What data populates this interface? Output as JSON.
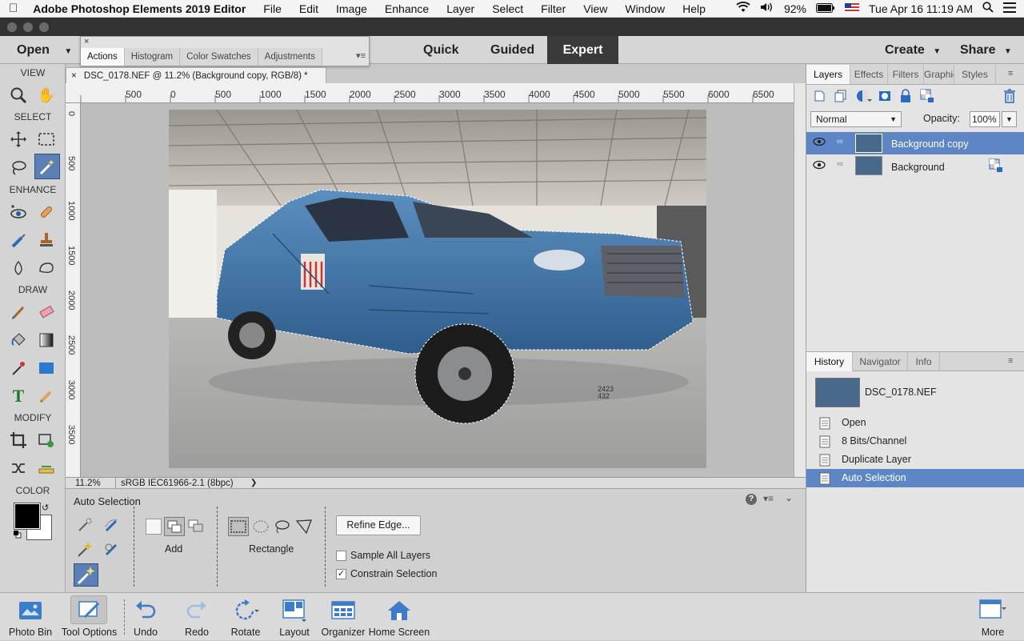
{
  "menubar": {
    "app": "Adobe Photoshop Elements 2019 Editor",
    "items": [
      "File",
      "Edit",
      "Image",
      "Enhance",
      "Layer",
      "Select",
      "Filter",
      "View",
      "Window",
      "Help"
    ],
    "battery": "92%",
    "datetime": "Tue Apr 16  11:19 AM"
  },
  "topbar": {
    "open": "Open",
    "modes": [
      "Quick",
      "Guided",
      "Expert"
    ],
    "create": "Create",
    "share": "Share"
  },
  "floatpanel": {
    "tabs": [
      "Actions",
      "Histogram",
      "Color Swatches",
      "Adjustments"
    ]
  },
  "toolbox": {
    "sections": [
      "VIEW",
      "SELECT",
      "ENHANCE",
      "DRAW",
      "MODIFY",
      "COLOR"
    ]
  },
  "document": {
    "tab_title": "DSC_0178.NEF @ 11.2% (Background copy, RGB/8) *",
    "ruler_h": [
      "500",
      "0",
      "500",
      "1000",
      "1500",
      "2000",
      "2500",
      "3000",
      "3500",
      "4000",
      "4500",
      "5000",
      "5500",
      "6000",
      "6500"
    ],
    "ruler_v": [
      "0",
      "500",
      "1000",
      "1500",
      "2000",
      "2500",
      "3000",
      "3500"
    ],
    "zoom": "11.2%",
    "profile": "sRGB IEC61966-2.1 (8bpc)",
    "cursor_readout": [
      "2423",
      "432"
    ]
  },
  "tool_options": {
    "title": "Auto Selection",
    "mode_label": "Add",
    "shape_label": "Rectangle",
    "refine": "Refine Edge...",
    "sample_all": "Sample All Layers",
    "constrain": "Constrain Selection",
    "sample_all_checked": false,
    "constrain_checked": true
  },
  "layers_panel": {
    "tabs": [
      "Layers",
      "Effects",
      "Filters",
      "Graphics",
      "Styles"
    ],
    "blend_mode": "Normal",
    "opacity_label": "Opacity:",
    "opacity": "100%",
    "layers": [
      "Background copy",
      "Background"
    ]
  },
  "history_panel": {
    "tabs": [
      "History",
      "Navigator",
      "Info"
    ],
    "file": "DSC_0178.NEF",
    "steps": [
      "Open",
      "8 Bits/Channel",
      "Duplicate Layer",
      "Auto Selection"
    ]
  },
  "bottombar": {
    "photo_bin": "Photo Bin",
    "tool_options": "Tool Options",
    "undo": "Undo",
    "redo": "Redo",
    "rotate": "Rotate",
    "layout": "Layout",
    "organizer": "Organizer",
    "home": "Home Screen",
    "more": "More"
  },
  "colors": {
    "accent": "#5e86c4",
    "truck": "#3f74a6"
  }
}
